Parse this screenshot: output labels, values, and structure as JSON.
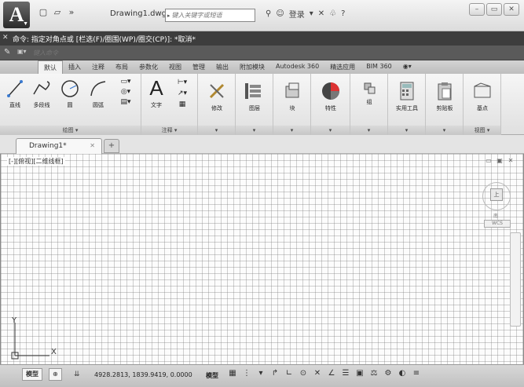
{
  "title_bar": {
    "app_letter": "A",
    "document_title": "Drawing1.dwg",
    "search_placeholder": "键入关键字或短语",
    "user_name": "登录",
    "help_icon": "?",
    "window_controls": [
      "–",
      "▭",
      "✕"
    ]
  },
  "command_line": {
    "history": "命令: 指定对角点或 [栏选(F)/圈围(WP)/圈交(CP)]: *取消*",
    "input_placeholder": "键入命令"
  },
  "ribbon": {
    "tabs": [
      "默认",
      "插入",
      "注释",
      "布局",
      "参数化",
      "视图",
      "管理",
      "输出",
      "附加模块",
      "Autodesk 360",
      "精选应用",
      "BIM 360"
    ],
    "active_tab": "默认",
    "draw_panel": {
      "tools": [
        "直线",
        "多段线",
        "圆",
        "圆弧"
      ],
      "footer": "绘图 ▾"
    },
    "annotation_panel": {
      "tools": [
        "文字"
      ],
      "footer": "注释 ▾"
    },
    "modify_panel": {
      "label": "修改",
      "footer": "▾"
    },
    "layers_panel": {
      "label": "图层",
      "footer": "▾"
    },
    "block_panel": {
      "label": "块",
      "footer": "▾"
    },
    "properties_panel": {
      "label": "特性",
      "footer": "▾"
    },
    "groups_panel": {
      "label": "组",
      "footer": "▾"
    },
    "utilities_panel": {
      "label": "实用工具",
      "footer": "▾"
    },
    "clipboard_panel": {
      "label": "剪贴板",
      "footer": "▾"
    },
    "view_panel": {
      "label": "基点",
      "footer": "视图 ▾"
    }
  },
  "file_tabs": {
    "active": "Drawing1*",
    "close": "✕",
    "new": "+"
  },
  "canvas": {
    "viewport_label": "[-][俯视][二维线框]",
    "viewcube_face": "上",
    "viewcube_south": "南",
    "wcs_label": "WCS",
    "ucs_x": "X",
    "ucs_y": "Y"
  },
  "status_bar": {
    "layout_model": "模型",
    "coordinates": "4928.2813, 1839.9419, 0.0000",
    "mode": "模型"
  }
}
